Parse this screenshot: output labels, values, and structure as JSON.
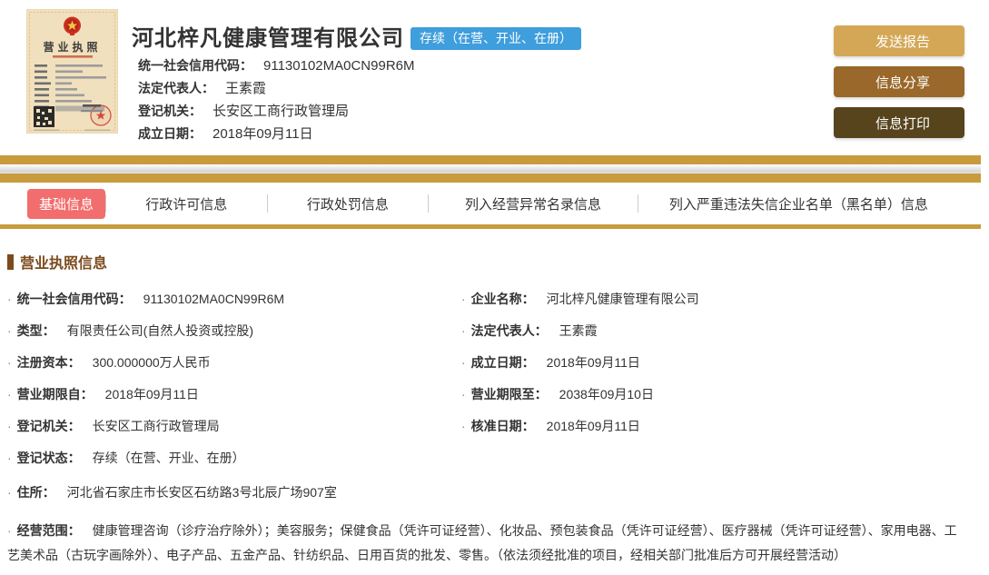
{
  "header": {
    "company_name": "河北梓凡健康管理有限公司",
    "status_badge": "存续（在营、开业、在册）",
    "license_image": {
      "title": "营业执照"
    },
    "fields": [
      {
        "label": "统一社会信用代码：",
        "value": "91130102MA0CN99R6M"
      },
      {
        "label": "法定代表人：",
        "value": "王素霞"
      },
      {
        "label": "登记机关：",
        "value": "长安区工商行政管理局"
      },
      {
        "label": "成立日期：",
        "value": "2018年09月11日"
      }
    ],
    "actions": [
      {
        "label": "发送报告"
      },
      {
        "label": "信息分享"
      },
      {
        "label": "信息打印"
      }
    ]
  },
  "tabs": [
    {
      "label": "基础信息",
      "active": true
    },
    {
      "label": "行政许可信息",
      "active": false
    },
    {
      "label": "行政处罚信息",
      "active": false
    },
    {
      "label": "列入经营异常名录信息",
      "active": false
    },
    {
      "label": "列入严重违法失信企业名单（黑名单）信息",
      "active": false
    }
  ],
  "license_info": {
    "title": "营业执照信息",
    "rows": [
      {
        "left": {
          "label": "统一社会信用代码：",
          "value": "91130102MA0CN99R6M"
        },
        "right": {
          "label": "企业名称：",
          "value": "河北梓凡健康管理有限公司"
        }
      },
      {
        "left": {
          "label": "类型：",
          "value": "有限责任公司(自然人投资或控股)"
        },
        "right": {
          "label": "法定代表人：",
          "value": "王素霞"
        }
      },
      {
        "left": {
          "label": "注册资本：",
          "value": "300.000000万人民币"
        },
        "right": {
          "label": "成立日期：",
          "value": "2018年09月11日"
        }
      },
      {
        "left": {
          "label": "营业期限自：",
          "value": "2018年09月11日"
        },
        "right": {
          "label": "营业期限至：",
          "value": "2038年09月10日"
        }
      },
      {
        "left": {
          "label": "登记机关：",
          "value": "长安区工商行政管理局"
        },
        "right": {
          "label": "核准日期：",
          "value": "2018年09月11日"
        }
      },
      {
        "left": {
          "label": "登记状态：",
          "value": "存续（在营、开业、在册）"
        }
      },
      {
        "left": {
          "label": "住所：",
          "value": "河北省石家庄市长安区石纺路3号北辰广场907室"
        }
      },
      {
        "full": {
          "label": "经营范围：",
          "value": "健康管理咨询（诊疗治疗除外）；美容服务；保健食品（凭许可证经营）、化妆品、预包装食品（凭许可证经营）、医疗器械（凭许可证经营）、家用电器、工艺美术品（古玩字画除外）、电子产品、五金产品、针纺织品、日用百货的批发、零售。（依法须经批准的项目，经相关部门批准后方可开展经营活动）"
        }
      }
    ]
  },
  "colors": {
    "gold_bar": "#c89b3c",
    "active_tab_red": "#f26d6d",
    "status_badge_blue": "#3f9edc",
    "button_send": "#d4a757",
    "button_share": "#99682a",
    "button_print": "#57441d",
    "section_brown": "#7b4a1d"
  }
}
